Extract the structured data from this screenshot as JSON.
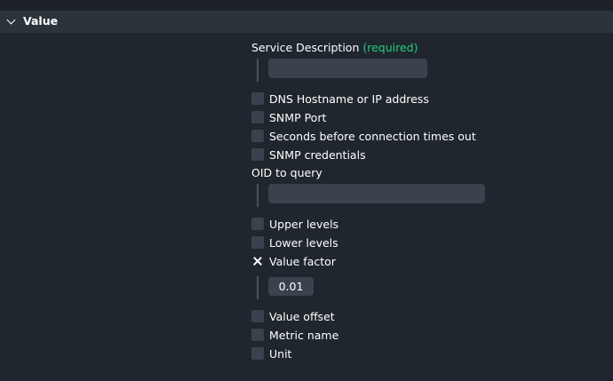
{
  "section": {
    "title": "Value"
  },
  "service_description": {
    "label": "Service Description",
    "required_tag": "(required)",
    "value": ""
  },
  "options_group1": [
    {
      "label": "DNS Hostname or IP address",
      "checked": false
    },
    {
      "label": "SNMP Port",
      "checked": false
    },
    {
      "label": "Seconds before connection times out",
      "checked": false
    },
    {
      "label": "SNMP credentials",
      "checked": false
    }
  ],
  "oid": {
    "label": "OID to query",
    "value": ""
  },
  "options_group2": [
    {
      "label": "Upper levels",
      "checked": false
    },
    {
      "label": "Lower levels",
      "checked": false
    },
    {
      "label": "Value factor",
      "checked": true
    }
  ],
  "value_factor": {
    "value": "0.01"
  },
  "options_group3": [
    {
      "label": "Value offset",
      "checked": false
    },
    {
      "label": "Metric name",
      "checked": false
    },
    {
      "label": "Unit",
      "checked": false
    }
  ],
  "colors": {
    "background": "#1f262d",
    "header": "#2b333b",
    "input": "#3a434d",
    "required": "#26d07c"
  }
}
